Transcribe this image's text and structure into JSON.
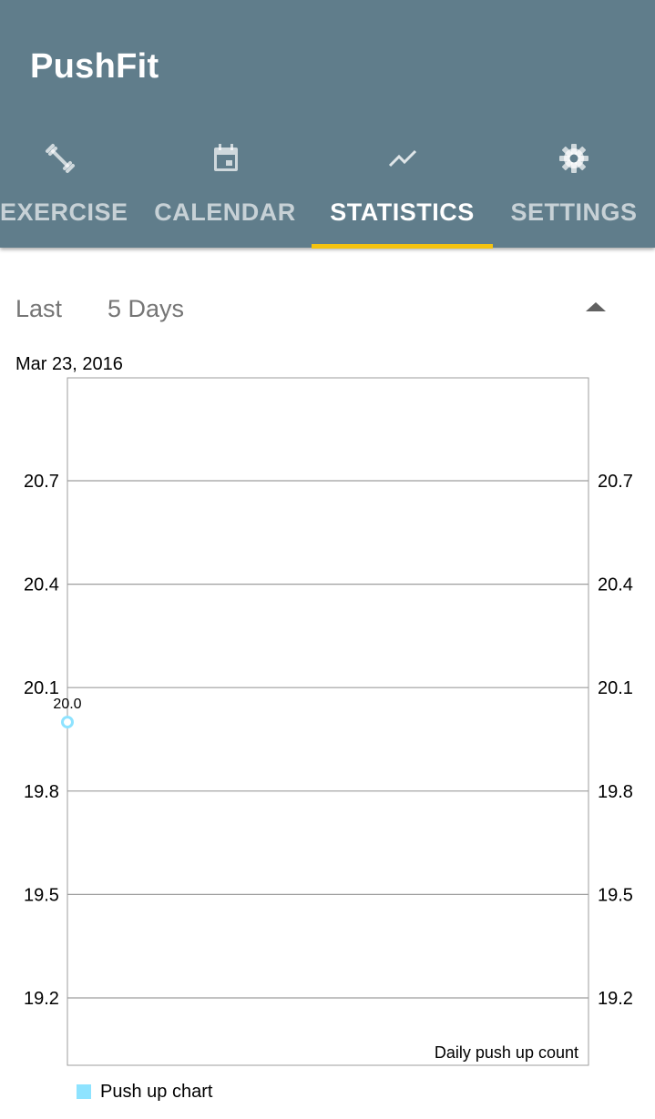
{
  "app": {
    "title": "PushFit"
  },
  "tabs": [
    {
      "label": "EXERCISE",
      "icon": "dumbbell-icon",
      "active": false
    },
    {
      "label": "CALENDAR",
      "icon": "calendar-icon",
      "active": false
    },
    {
      "label": "STATISTICS",
      "icon": "trending-up-icon",
      "active": true
    },
    {
      "label": "SETTINGS",
      "icon": "gear-icon",
      "active": false
    }
  ],
  "colors": {
    "appbar": "#607d8b",
    "indicator": "#f5c30f",
    "series": "#8ee3ff"
  },
  "range": {
    "prefix": "Last",
    "selected": "5 Days",
    "icon": "dropdown-up-arrow-icon"
  },
  "chart_data": {
    "type": "line",
    "title": "Mar 23, 2016",
    "description": "Daily push up count",
    "y_ticks": [
      "20.7",
      "20.4",
      "20.1",
      "19.8",
      "19.5",
      "19.2"
    ],
    "ylim": [
      19.0,
      21.0
    ],
    "grid": true,
    "legend_position": "bottom-left",
    "series": [
      {
        "name": "Push up chart",
        "points": [
          {
            "x": "Mar 23, 2016",
            "y": 20.0,
            "label": "20.0"
          }
        ]
      }
    ]
  }
}
